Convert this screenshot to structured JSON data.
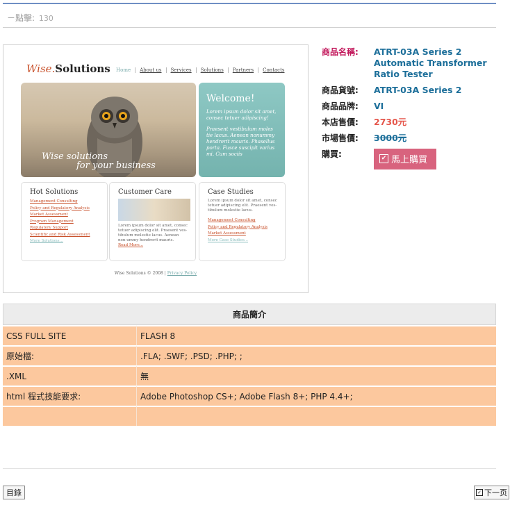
{
  "hits": {
    "label": "－點擊:",
    "count": "130"
  },
  "preview": {
    "logo_wise": "Wise.",
    "logo_solutions": "Solutions",
    "nav": [
      "Home",
      "About us",
      "Services",
      "Solutions",
      "Partners",
      "Contacts"
    ],
    "banner_tag_line1": "Wise solutions",
    "banner_tag_line2": "for your business",
    "welcome_title": "Welcome!",
    "welcome_text1": "Lorem ipsum dolor sit amet, consec tetuer adipiscing!",
    "welcome_text2": "Praesent vestibulum moles tie lacus. Aenean nonummy hendrerit mauris. Phasellus porta. Fusce suscipit varius mi. Cum sociis",
    "hot_title": "Hot Solutions",
    "hot_items": [
      "Management Consulting",
      "Policy and Regulatory Analysis",
      "Market Assessment",
      "Program Management",
      "Regulatory Support",
      "Scientific and Risk Assessment",
      "More Solutions..."
    ],
    "care_title": "Customer Care",
    "care_text": "Lorem ipsum dolor sit amet, consec tetuer adipiscing elit. Praesent ves-tibulum molestie lacus. Aenean non-ummy hendrerit mauris.",
    "care_more": "Read More...",
    "case_title": "Case Studies",
    "case_text": "Lorem ipsum dolor sit amet, consec tetuer adipiscing elit. Praesent ves-tibulum molestie lacus.",
    "case_items": [
      "Management Consulting",
      "Policy and Regulatory Analysis",
      "Market Assessment",
      "More Case Studies..."
    ],
    "footer": "Wise Solutions © 2008 |",
    "footer_link": "Privacy Policy"
  },
  "product": {
    "name_label": "商品名稱:",
    "name_value": "ATRT-03A Series 2 Automatic Transformer Ratio Tester",
    "code_label": "商品貨號:",
    "code_value": "ATRT-03A Series 2",
    "brand_label": "商品品牌:",
    "brand_value": "VI",
    "store_price_label": "本店售價:",
    "store_price_value": "2730元",
    "market_price_label": "市場售價:",
    "market_price_value": "3000元",
    "buy_label": "購買:",
    "buy_button": "馬上購買"
  },
  "intro": {
    "title": "商品簡介",
    "rows": [
      {
        "k": "CSS FULL SITE",
        "v": "FLASH 8"
      },
      {
        "k": "原始檔:",
        "v": " .FLA; .SWF; .PSD; .PHP; ;"
      },
      {
        "k": ".XML",
        "v": "無"
      },
      {
        "k": "html 程式技能要求:",
        "v": "Adobe Photoshop CS+; Adobe Flash 8+; PHP 4.4+;"
      },
      {
        "k": "",
        "v": ""
      }
    ]
  },
  "nav": {
    "catalog": "目錄",
    "next": "下一页"
  },
  "colors": {
    "accent": "#d8637e",
    "link": "#1d6f9a",
    "price": "#e5564b",
    "table_bg": "#fcc89e"
  }
}
